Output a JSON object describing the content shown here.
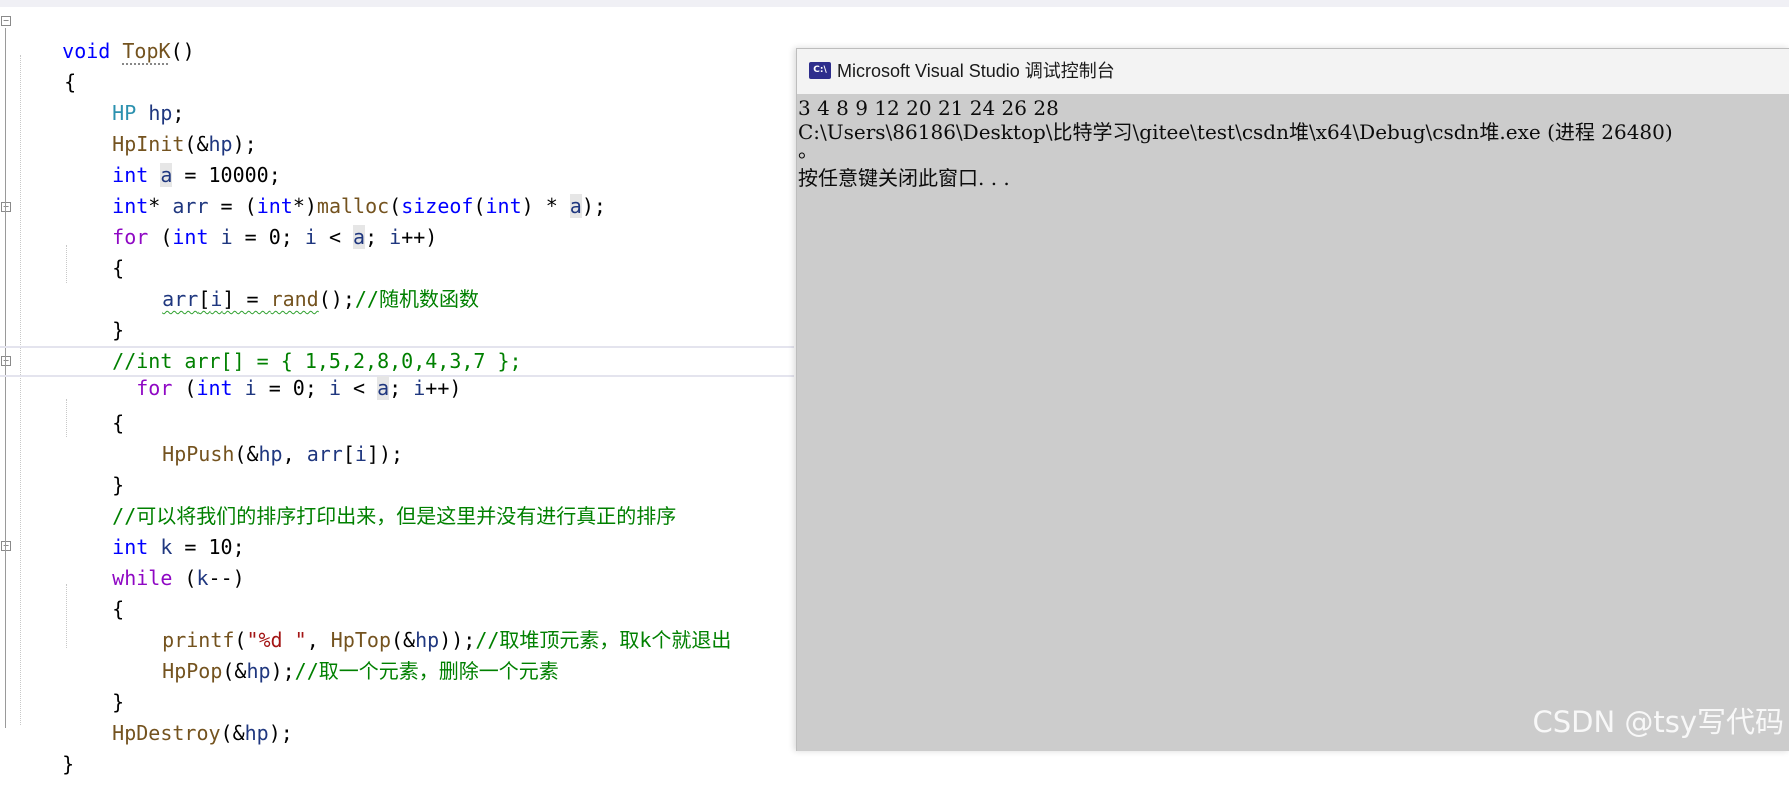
{
  "editor": {
    "lines": [
      {
        "parts": [
          [
            "k",
            "void"
          ],
          [
            "",
            ""
          ],
          [
            "f",
            "TopK"
          ],
          [
            "",
            "()"
          ]
        ]
      },
      {
        "parts": [
          [
            "",
            "{"
          ]
        ]
      },
      {
        "parts": [
          [
            "t",
            "HP"
          ],
          [
            "",
            " "
          ],
          [
            "v",
            "hp"
          ],
          [
            "",
            ";"
          ]
        ]
      },
      {
        "parts": [
          [
            "f",
            "HpInit"
          ],
          [
            "",
            "(&"
          ],
          [
            "v",
            "hp"
          ],
          [
            "",
            ");"
          ]
        ]
      },
      {
        "parts": [
          [
            "k",
            "int"
          ],
          [
            "",
            " "
          ],
          [
            "v",
            "a"
          ],
          [
            "",
            " = 10000;"
          ]
        ]
      },
      {
        "parts": [
          [
            "k",
            "int"
          ],
          [
            "",
            "* "
          ],
          [
            "v",
            "arr"
          ],
          [
            "",
            " = ("
          ],
          [
            "k",
            "int"
          ],
          [
            "",
            "*)"
          ],
          [
            "f",
            "malloc"
          ],
          [
            "",
            "("
          ],
          [
            "k",
            "sizeof"
          ],
          [
            "",
            "("
          ],
          [
            "k",
            "int"
          ],
          [
            "",
            ") * "
          ],
          [
            "v",
            "a"
          ],
          [
            "",
            ");"
          ]
        ]
      },
      {
        "parts": [
          [
            "ctl",
            "for"
          ],
          [
            "",
            " ("
          ],
          [
            "k",
            "int"
          ],
          [
            "",
            " "
          ],
          [
            "v",
            "i"
          ],
          [
            "",
            " = 0; "
          ],
          [
            "v",
            "i"
          ],
          [
            "",
            " < "
          ],
          [
            "v",
            "a"
          ],
          [
            "",
            "; "
          ],
          [
            "v",
            "i"
          ],
          [
            "",
            "++)"
          ]
        ]
      },
      {
        "parts": [
          [
            "",
            "{"
          ]
        ]
      },
      {
        "parts": [
          [
            "v",
            "arr"
          ],
          [
            "",
            "["
          ],
          [
            "v",
            "i"
          ],
          [
            "",
            "] = "
          ],
          [
            "f",
            "rand"
          ],
          [
            "",
            "();"
          ],
          [
            "c",
            "//随机数函数"
          ]
        ]
      },
      {
        "parts": [
          [
            "",
            "}"
          ]
        ]
      },
      {
        "parts": [
          [
            "c",
            "//int arr[] = { 1,5,2,8,0,4,3,7 };"
          ]
        ]
      },
      {
        "parts": [
          [
            "ctl",
            "for"
          ],
          [
            "",
            " ("
          ],
          [
            "k",
            "int"
          ],
          [
            "",
            " "
          ],
          [
            "v",
            "i"
          ],
          [
            "",
            " = 0; "
          ],
          [
            "v",
            "i"
          ],
          [
            "",
            " < "
          ],
          [
            "v",
            "a"
          ],
          [
            "",
            "; "
          ],
          [
            "v",
            "i"
          ],
          [
            "",
            "++)"
          ]
        ]
      },
      {
        "parts": [
          [
            "",
            "{"
          ]
        ]
      },
      {
        "parts": [
          [
            "f",
            "HpPush"
          ],
          [
            "",
            "(&"
          ],
          [
            "v",
            "hp"
          ],
          [
            "",
            ", "
          ],
          [
            "v",
            "arr"
          ],
          [
            "",
            "["
          ],
          [
            "v",
            "i"
          ],
          [
            "",
            "]);"
          ]
        ]
      },
      {
        "parts": [
          [
            "",
            "}"
          ]
        ]
      },
      {
        "parts": [
          [
            "c",
            "//可以将我们的排序打印出来，但是这里并没有进行真正的排序"
          ]
        ]
      },
      {
        "parts": [
          [
            "k",
            "int"
          ],
          [
            "",
            " "
          ],
          [
            "v",
            "k"
          ],
          [
            "",
            " = 10;"
          ]
        ]
      },
      {
        "parts": [
          [
            "ctl",
            "while"
          ],
          [
            "",
            " ("
          ],
          [
            "v",
            "k"
          ],
          [
            "",
            "--)"
          ]
        ]
      },
      {
        "parts": [
          [
            "",
            "{"
          ]
        ]
      },
      {
        "parts": [
          [
            "f",
            "printf"
          ],
          [
            "",
            "("
          ],
          [
            "s",
            "\"%d \""
          ],
          [
            "",
            ", "
          ],
          [
            "f",
            "HpTop"
          ],
          [
            "",
            "(&"
          ],
          [
            "v",
            "hp"
          ],
          [
            "",
            "));"
          ],
          [
            "c",
            "//取堆顶元素，取k个就退出"
          ]
        ]
      },
      {
        "parts": [
          [
            "f",
            "HpPop"
          ],
          [
            "",
            "(&"
          ],
          [
            "v",
            "hp"
          ],
          [
            "",
            ");"
          ],
          [
            "c",
            "//取一个元素，删除一个元素"
          ]
        ]
      },
      {
        "parts": [
          [
            "",
            "}"
          ]
        ]
      },
      {
        "parts": [
          [
            "f",
            "HpDestroy"
          ],
          [
            "",
            "(&"
          ],
          [
            "v",
            "hp"
          ],
          [
            "",
            ");"
          ]
        ]
      },
      {
        "parts": [
          [
            "",
            "}"
          ]
        ]
      }
    ]
  },
  "console": {
    "icon_label": "C:\\",
    "title": "Microsoft Visual Studio 调试控制台",
    "lines": [
      "3 4 8 9 12 20 21 24 26 28",
      "C:\\Users\\86186\\Desktop\\比特学习\\gitee\\test\\csdn堆\\x64\\Debug\\csdn堆.exe (进程 26480)",
      "。",
      "按任意键关闭此窗口. . ."
    ]
  },
  "watermark": "CSDN @tsy写代码",
  "colors": {
    "keyword": "#0000ff",
    "type": "#2b91af",
    "function": "#74531f",
    "variable": "#1f377f",
    "comment": "#008000",
    "string": "#a31515",
    "control": "#8f08c4",
    "console_bg": "#cccccc"
  }
}
